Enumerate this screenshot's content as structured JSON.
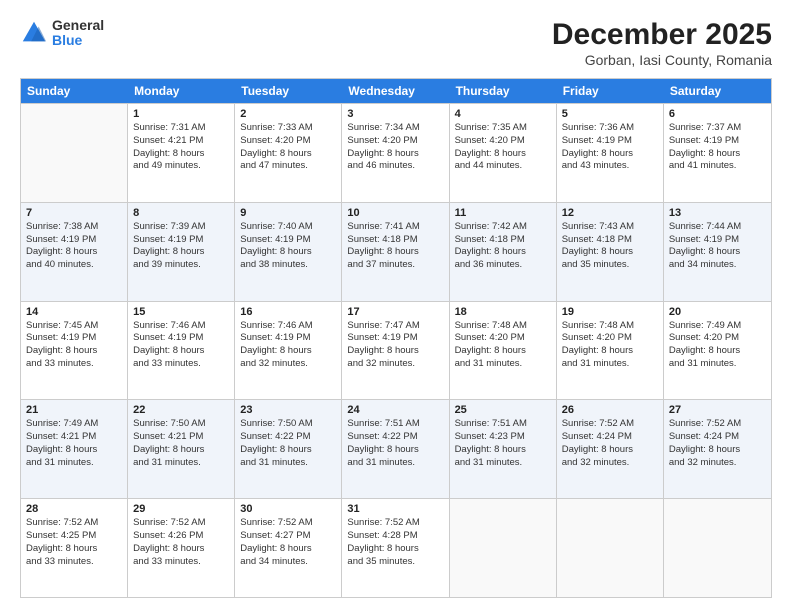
{
  "header": {
    "logo_general": "General",
    "logo_blue": "Blue",
    "month_title": "December 2025",
    "location": "Gorban, Iasi County, Romania"
  },
  "calendar": {
    "days_of_week": [
      "Sunday",
      "Monday",
      "Tuesday",
      "Wednesday",
      "Thursday",
      "Friday",
      "Saturday"
    ],
    "rows": [
      [
        {
          "day": "",
          "lines": [],
          "empty": true
        },
        {
          "day": "1",
          "lines": [
            "Sunrise: 7:31 AM",
            "Sunset: 4:21 PM",
            "Daylight: 8 hours",
            "and 49 minutes."
          ]
        },
        {
          "day": "2",
          "lines": [
            "Sunrise: 7:33 AM",
            "Sunset: 4:20 PM",
            "Daylight: 8 hours",
            "and 47 minutes."
          ]
        },
        {
          "day": "3",
          "lines": [
            "Sunrise: 7:34 AM",
            "Sunset: 4:20 PM",
            "Daylight: 8 hours",
            "and 46 minutes."
          ]
        },
        {
          "day": "4",
          "lines": [
            "Sunrise: 7:35 AM",
            "Sunset: 4:20 PM",
            "Daylight: 8 hours",
            "and 44 minutes."
          ]
        },
        {
          "day": "5",
          "lines": [
            "Sunrise: 7:36 AM",
            "Sunset: 4:19 PM",
            "Daylight: 8 hours",
            "and 43 minutes."
          ]
        },
        {
          "day": "6",
          "lines": [
            "Sunrise: 7:37 AM",
            "Sunset: 4:19 PM",
            "Daylight: 8 hours",
            "and 41 minutes."
          ]
        }
      ],
      [
        {
          "day": "7",
          "lines": [
            "Sunrise: 7:38 AM",
            "Sunset: 4:19 PM",
            "Daylight: 8 hours",
            "and 40 minutes."
          ]
        },
        {
          "day": "8",
          "lines": [
            "Sunrise: 7:39 AM",
            "Sunset: 4:19 PM",
            "Daylight: 8 hours",
            "and 39 minutes."
          ]
        },
        {
          "day": "9",
          "lines": [
            "Sunrise: 7:40 AM",
            "Sunset: 4:19 PM",
            "Daylight: 8 hours",
            "and 38 minutes."
          ]
        },
        {
          "day": "10",
          "lines": [
            "Sunrise: 7:41 AM",
            "Sunset: 4:18 PM",
            "Daylight: 8 hours",
            "and 37 minutes."
          ]
        },
        {
          "day": "11",
          "lines": [
            "Sunrise: 7:42 AM",
            "Sunset: 4:18 PM",
            "Daylight: 8 hours",
            "and 36 minutes."
          ]
        },
        {
          "day": "12",
          "lines": [
            "Sunrise: 7:43 AM",
            "Sunset: 4:18 PM",
            "Daylight: 8 hours",
            "and 35 minutes."
          ]
        },
        {
          "day": "13",
          "lines": [
            "Sunrise: 7:44 AM",
            "Sunset: 4:19 PM",
            "Daylight: 8 hours",
            "and 34 minutes."
          ]
        }
      ],
      [
        {
          "day": "14",
          "lines": [
            "Sunrise: 7:45 AM",
            "Sunset: 4:19 PM",
            "Daylight: 8 hours",
            "and 33 minutes."
          ]
        },
        {
          "day": "15",
          "lines": [
            "Sunrise: 7:46 AM",
            "Sunset: 4:19 PM",
            "Daylight: 8 hours",
            "and 33 minutes."
          ]
        },
        {
          "day": "16",
          "lines": [
            "Sunrise: 7:46 AM",
            "Sunset: 4:19 PM",
            "Daylight: 8 hours",
            "and 32 minutes."
          ]
        },
        {
          "day": "17",
          "lines": [
            "Sunrise: 7:47 AM",
            "Sunset: 4:19 PM",
            "Daylight: 8 hours",
            "and 32 minutes."
          ]
        },
        {
          "day": "18",
          "lines": [
            "Sunrise: 7:48 AM",
            "Sunset: 4:20 PM",
            "Daylight: 8 hours",
            "and 31 minutes."
          ]
        },
        {
          "day": "19",
          "lines": [
            "Sunrise: 7:48 AM",
            "Sunset: 4:20 PM",
            "Daylight: 8 hours",
            "and 31 minutes."
          ]
        },
        {
          "day": "20",
          "lines": [
            "Sunrise: 7:49 AM",
            "Sunset: 4:20 PM",
            "Daylight: 8 hours",
            "and 31 minutes."
          ]
        }
      ],
      [
        {
          "day": "21",
          "lines": [
            "Sunrise: 7:49 AM",
            "Sunset: 4:21 PM",
            "Daylight: 8 hours",
            "and 31 minutes."
          ]
        },
        {
          "day": "22",
          "lines": [
            "Sunrise: 7:50 AM",
            "Sunset: 4:21 PM",
            "Daylight: 8 hours",
            "and 31 minutes."
          ]
        },
        {
          "day": "23",
          "lines": [
            "Sunrise: 7:50 AM",
            "Sunset: 4:22 PM",
            "Daylight: 8 hours",
            "and 31 minutes."
          ]
        },
        {
          "day": "24",
          "lines": [
            "Sunrise: 7:51 AM",
            "Sunset: 4:22 PM",
            "Daylight: 8 hours",
            "and 31 minutes."
          ]
        },
        {
          "day": "25",
          "lines": [
            "Sunrise: 7:51 AM",
            "Sunset: 4:23 PM",
            "Daylight: 8 hours",
            "and 31 minutes."
          ]
        },
        {
          "day": "26",
          "lines": [
            "Sunrise: 7:52 AM",
            "Sunset: 4:24 PM",
            "Daylight: 8 hours",
            "and 32 minutes."
          ]
        },
        {
          "day": "27",
          "lines": [
            "Sunrise: 7:52 AM",
            "Sunset: 4:24 PM",
            "Daylight: 8 hours",
            "and 32 minutes."
          ]
        }
      ],
      [
        {
          "day": "28",
          "lines": [
            "Sunrise: 7:52 AM",
            "Sunset: 4:25 PM",
            "Daylight: 8 hours",
            "and 33 minutes."
          ]
        },
        {
          "day": "29",
          "lines": [
            "Sunrise: 7:52 AM",
            "Sunset: 4:26 PM",
            "Daylight: 8 hours",
            "and 33 minutes."
          ]
        },
        {
          "day": "30",
          "lines": [
            "Sunrise: 7:52 AM",
            "Sunset: 4:27 PM",
            "Daylight: 8 hours",
            "and 34 minutes."
          ]
        },
        {
          "day": "31",
          "lines": [
            "Sunrise: 7:52 AM",
            "Sunset: 4:28 PM",
            "Daylight: 8 hours",
            "and 35 minutes."
          ]
        },
        {
          "day": "",
          "lines": [],
          "empty": true
        },
        {
          "day": "",
          "lines": [],
          "empty": true
        },
        {
          "day": "",
          "lines": [],
          "empty": true
        }
      ]
    ]
  }
}
